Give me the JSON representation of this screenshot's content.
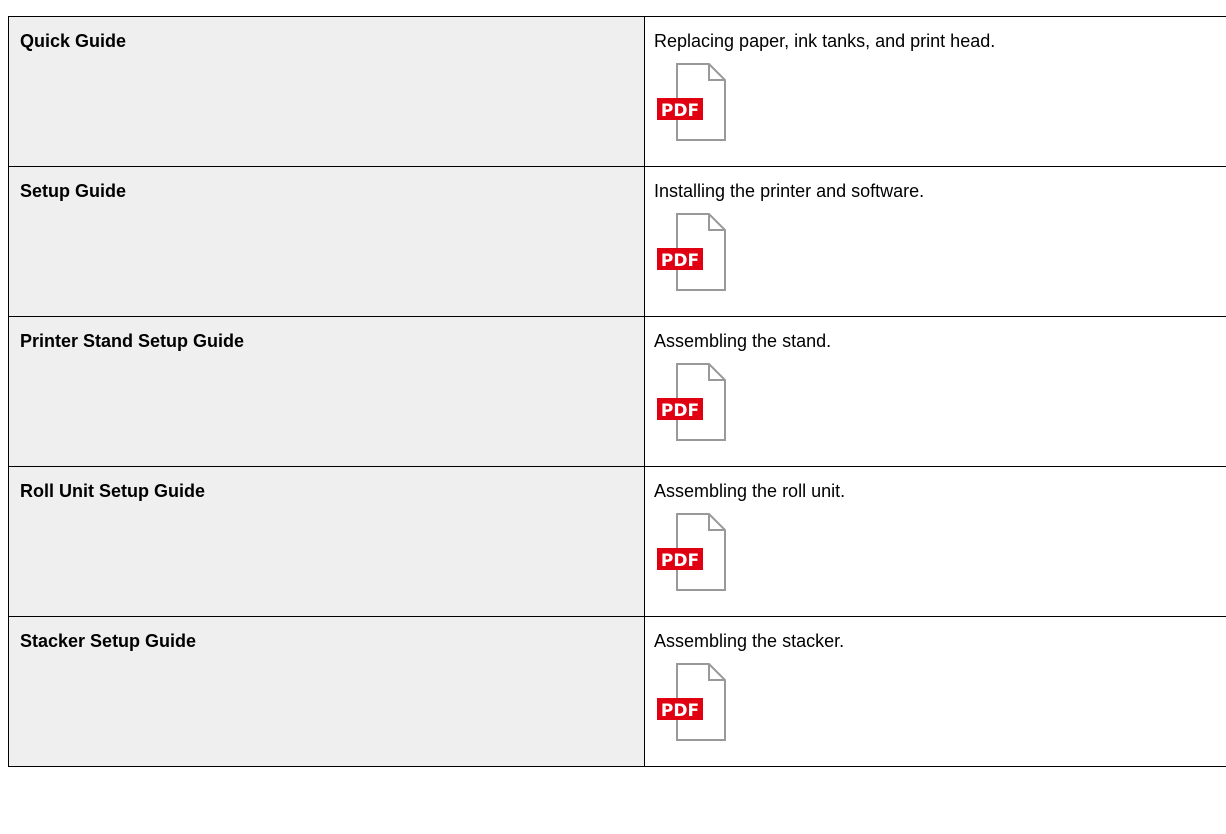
{
  "guides": [
    {
      "name": "Quick Guide",
      "description": "Replacing paper, ink tanks, and print head.",
      "icon": "pdf-icon",
      "icon_label": "PDF"
    },
    {
      "name": "Setup Guide",
      "description": "Installing the printer and software.",
      "icon": "pdf-icon",
      "icon_label": "PDF"
    },
    {
      "name": "Printer Stand Setup Guide",
      "description": "Assembling the stand.",
      "icon": "pdf-icon",
      "icon_label": "PDF"
    },
    {
      "name": "Roll Unit Setup Guide",
      "description": "Assembling the roll unit.",
      "icon": "pdf-icon",
      "icon_label": "PDF"
    },
    {
      "name": "Stacker Setup Guide",
      "description": "Assembling the stacker.",
      "icon": "pdf-icon",
      "icon_label": "PDF"
    }
  ],
  "colors": {
    "name_cell_bg": "#efefef",
    "border": "#000000",
    "pdf_badge": "#e00012",
    "pdf_text": "#ffffff",
    "doc_outline": "#999999"
  }
}
